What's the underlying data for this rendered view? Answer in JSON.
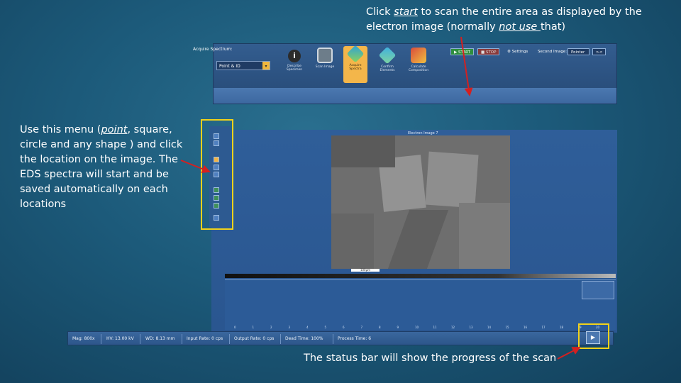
{
  "captions": {
    "top": {
      "pre": "Click ",
      "start": "start",
      "mid": " to scan the entire area as displayed by the electron image (normally ",
      "not_use": "not use ",
      "post": "that)"
    },
    "left": {
      "pre": "Use this menu (",
      "point": "point",
      "post": ", square, circle and any shape ) and click the location on the image. The EDS spectra will start and be saved automatically on each locations"
    },
    "bottom": "The status bar will show the progress of the scan"
  },
  "ribbon": {
    "mode": "Point & ID",
    "steps": [
      {
        "label": "Describe Specimen",
        "icon": "info-icon",
        "color": "#2b2b2b"
      },
      {
        "label": "Scan Image",
        "icon": "image-icon",
        "color": "#6d7d8a"
      },
      {
        "label": "Acquire Spectra",
        "icon": "spectrum-icon",
        "color": "#2fa1d8",
        "active": true
      },
      {
        "label": "Confirm Elements",
        "icon": "elements-icon",
        "color": "#3fb0e0"
      },
      {
        "label": "Calculate Composition",
        "icon": "composition-icon",
        "color": "#d94c3c"
      }
    ],
    "acquire_label": "Acquire Spectrum:",
    "start_label": "START",
    "stop_label": "STOP",
    "settings_label": "Settings",
    "second_image_label": "Second Image:",
    "second_image_value": "Pointer"
  },
  "image_window": {
    "title": "Electron Image 7",
    "scale": "100µm"
  },
  "status_bar": {
    "mag": "Mag: 800x",
    "hv": "HV: 13.00 kV",
    "wd": "WD: 8.13 mm",
    "input_rate": "Input Rate: 0 cps",
    "output_rate": "Output Rate: 0 cps",
    "dead_time": "Dead Time: 100%",
    "process_time": "Process Time: 6"
  },
  "spectrum_axis": [
    "0",
    "1",
    "2",
    "3",
    "4",
    "5",
    "6",
    "7",
    "8",
    "9",
    "10",
    "11",
    "12",
    "13",
    "14",
    "15",
    "16",
    "17",
    "18",
    "19",
    "20"
  ],
  "colors": {
    "highlight": "#f2d21a",
    "arrow": "#d42020",
    "active_step": "#f4b64a"
  }
}
